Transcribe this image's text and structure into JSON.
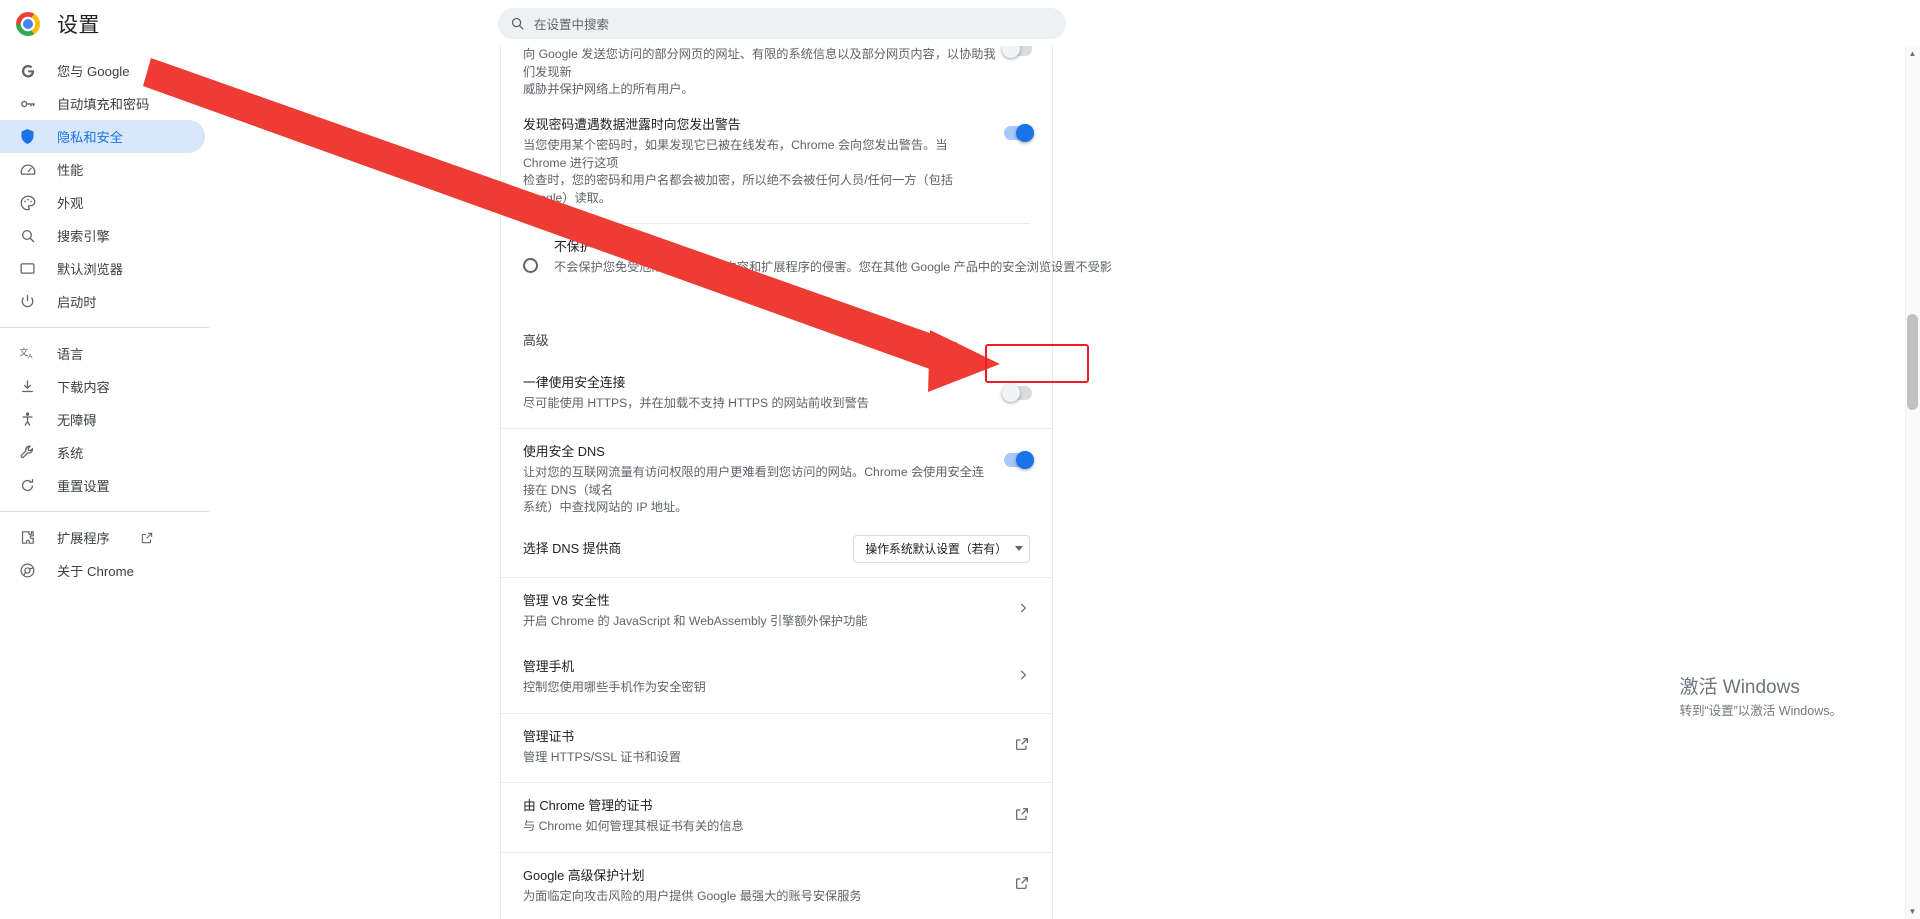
{
  "topbar": {
    "app_title": "设置",
    "logo_icon": "chrome-logo-icon",
    "search": {
      "placeholder": "在设置中搜索",
      "value": "",
      "icon": "search-icon"
    }
  },
  "sidebar": {
    "groups": [
      {
        "items": [
          {
            "label": "您与 Google",
            "icon": "google-g-icon",
            "selected": false
          },
          {
            "label": "自动填充和密码",
            "icon": "key-icon",
            "selected": false
          },
          {
            "label": "隐私和安全",
            "icon": "shield-icon",
            "selected": true
          },
          {
            "label": "性能",
            "icon": "speedometer-icon",
            "selected": false
          },
          {
            "label": "外观",
            "icon": "palette-icon",
            "selected": false
          },
          {
            "label": "搜索引擎",
            "icon": "search-icon",
            "selected": false
          },
          {
            "label": "默认浏览器",
            "icon": "browser-window-icon",
            "selected": false
          },
          {
            "label": "启动时",
            "icon": "power-icon",
            "selected": false
          }
        ]
      },
      {
        "items": [
          {
            "label": "语言",
            "icon": "translate-icon",
            "selected": false
          },
          {
            "label": "下载内容",
            "icon": "download-icon",
            "selected": false
          },
          {
            "label": "无障碍",
            "icon": "accessibility-icon",
            "selected": false
          },
          {
            "label": "系统",
            "icon": "wrench-icon",
            "selected": false
          },
          {
            "label": "重置设置",
            "icon": "restore-icon",
            "selected": false
          }
        ]
      },
      {
        "items": [
          {
            "label": "扩展程序",
            "icon": "extension-puzzle-icon",
            "selected": false,
            "external": true
          },
          {
            "label": "关于 Chrome",
            "icon": "chrome-outline-icon",
            "selected": false
          }
        ]
      }
    ]
  },
  "main": {
    "safe_browsing_tail": {
      "desc_line1": "向 Google 发送您访问的部分网页的网址、有限的系统信息以及部分网页内容，以协助我们发现新",
      "desc_line2": "威胁并保护网络上的所有用户。",
      "toggle_state": "off"
    },
    "leaked_password_warning": {
      "title": "发现密码遭遇数据泄露时向您发出警告",
      "desc_line1": "当您使用某个密码时，如果发现它已被在线发布，Chrome 会向您发出警告。当 Chrome 进行这项",
      "desc_line2": "检查时，您的密码和用户名都会被加密，所以绝不会被任何人员/任何一方（包括 Google）读取。",
      "toggle_state": "on"
    },
    "no_protection": {
      "title": "不保护（不建议）",
      "desc": "不会保护您免受危险网站、下载内容和扩展程序的侵害。您在其他 Google 产品中的安全浏览设置不受影",
      "radio_state": "off"
    },
    "advanced_header": "高级",
    "always_secure_connections": {
      "title": "一律使用安全连接",
      "desc": "尽可能使用 HTTPS，并在加载不支持 HTTPS 的网站前收到警告",
      "toggle_state": "off"
    },
    "use_secure_dns": {
      "title": "使用安全 DNS",
      "desc_line1": "让对您的互联网流量有访问权限的用户更难看到您访问的网站。Chrome 会使用安全连接在 DNS（域名",
      "desc_line2": "系统）中查找网站的 IP 地址。",
      "toggle_state": "on",
      "highlighted": true
    },
    "dns_provider": {
      "label": "选择 DNS 提供商",
      "selected_option": "操作系统默认设置（若有）",
      "dropdown_icon": "caret-down-icon"
    },
    "list_rows": [
      {
        "title": "管理 V8 安全性",
        "desc": "开启 Chrome 的 JavaScript 和 WebAssembly 引擎额外保护功能",
        "action_icon": "chevron-right-icon"
      },
      {
        "title": "管理手机",
        "desc": "控制您使用哪些手机作为安全密钥",
        "action_icon": "chevron-right-icon"
      },
      {
        "title": "管理证书",
        "desc": "管理 HTTPS/SSL 证书和设置",
        "action_icon": "open-in-new-icon"
      },
      {
        "title": "由 Chrome 管理的证书",
        "desc": "与 Chrome 如何管理其根证书有关的信息",
        "action_icon": "open-in-new-icon"
      },
      {
        "title": "Google 高级保护计划",
        "desc": "为面临定向攻击风险的用户提供 Google 最强大的账号安保服务",
        "action_icon": "open-in-new-icon"
      }
    ]
  },
  "annotation": {
    "arrow_color": "#ee3b33",
    "highlight_box_color": "#ee1c24"
  },
  "watermark": {
    "line1": "激活 Windows",
    "line2": "转到“设置”以激活 Windows。"
  },
  "colors": {
    "accent": "#1a73e8",
    "selected_bg": "#d9e7fd",
    "text_primary": "#202124",
    "text_secondary": "#5f6368",
    "divider": "#e8eaed"
  }
}
